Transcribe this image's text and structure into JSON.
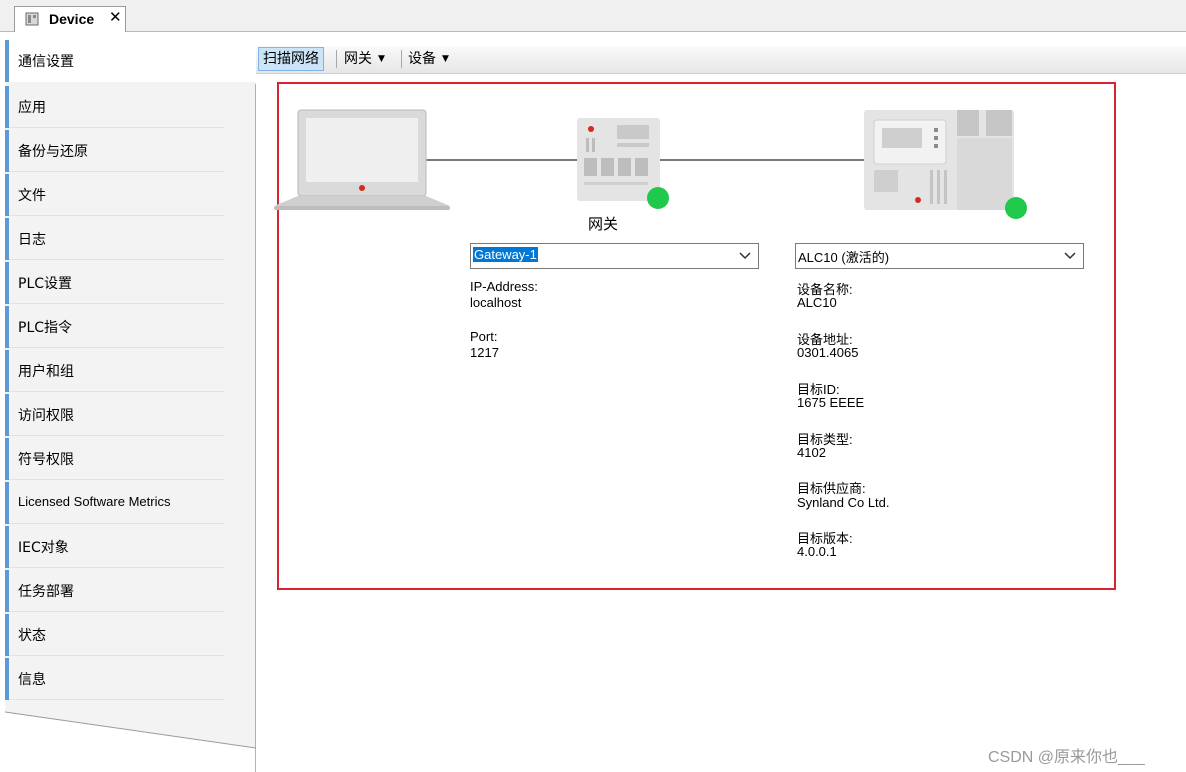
{
  "tab": {
    "title": "Device",
    "close": "✕"
  },
  "nav": {
    "items": [
      {
        "label": "通信设置"
      },
      {
        "label": "应用"
      },
      {
        "label": "备份与还原"
      },
      {
        "label": "文件"
      },
      {
        "label": "日志"
      },
      {
        "label": "PLC设置"
      },
      {
        "label": "PLC指令"
      },
      {
        "label": "用户和组"
      },
      {
        "label": "访问权限"
      },
      {
        "label": "符号权限"
      },
      {
        "label": "Licensed Software Metrics"
      },
      {
        "label": "IEC对象"
      },
      {
        "label": "任务部署"
      },
      {
        "label": "状态"
      },
      {
        "label": "信息"
      }
    ]
  },
  "toolbar": {
    "scan": "扫描网络",
    "gateway": "网关",
    "device": "设备"
  },
  "gateway": {
    "caption": "网关",
    "selected": "Gateway-1",
    "ip_label": "IP-Address:",
    "ip_value": "localhost",
    "port_label": "Port:",
    "port_value": "1217"
  },
  "device": {
    "selected": "ALC10 (激活的)",
    "fields": [
      {
        "label": "设备名称:",
        "value": "ALC10"
      },
      {
        "label": "设备地址:",
        "value": "0301.4065"
      },
      {
        "label": "目标ID:",
        "value": "1675  EEEE"
      },
      {
        "label": "目标类型:",
        "value": "4102"
      },
      {
        "label": "目标供应商:",
        "value": "Synland Co Ltd."
      },
      {
        "label": "目标版本:",
        "value": "4.0.0.1"
      }
    ]
  },
  "colors": {
    "frame": "#d9232f",
    "status_ok": "#1ec94c",
    "nav_accent": "#5b9bd5",
    "selection": "#0078d7"
  },
  "watermark": "CSDN @原来你也___"
}
